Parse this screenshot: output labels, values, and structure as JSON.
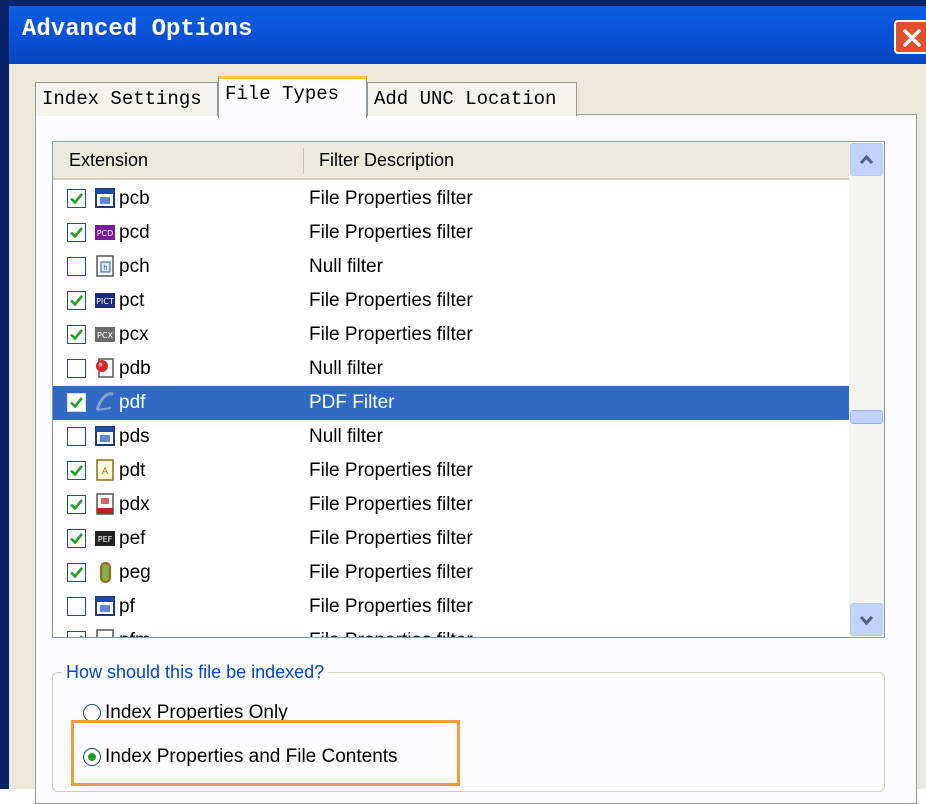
{
  "window": {
    "title": "Advanced Options"
  },
  "tabs": [
    {
      "label": "Index Settings",
      "active": false
    },
    {
      "label": "File Types",
      "active": true
    },
    {
      "label": "Add UNC Location",
      "active": false
    }
  ],
  "list": {
    "columns": {
      "extension": "Extension",
      "description": "Filter Description"
    },
    "rows": [
      {
        "checked": true,
        "ext": "pcb",
        "desc": "File Properties filter",
        "icon": "app-window-icon",
        "selected": false
      },
      {
        "checked": true,
        "ext": "pcd",
        "desc": "File Properties filter",
        "icon": "pcd-image-icon",
        "selected": false
      },
      {
        "checked": false,
        "ext": "pch",
        "desc": "Null filter",
        "icon": "header-file-icon",
        "selected": false
      },
      {
        "checked": true,
        "ext": "pct",
        "desc": "File Properties filter",
        "icon": "pict-image-icon",
        "selected": false
      },
      {
        "checked": true,
        "ext": "pcx",
        "desc": "File Properties filter",
        "icon": "pcx-image-icon",
        "selected": false
      },
      {
        "checked": false,
        "ext": "pdb",
        "desc": "Null filter",
        "icon": "database-file-icon",
        "selected": false
      },
      {
        "checked": true,
        "ext": "pdf",
        "desc": "PDF Filter",
        "icon": "pdf-file-icon",
        "selected": true
      },
      {
        "checked": false,
        "ext": "pds",
        "desc": "Null filter",
        "icon": "app-window-icon",
        "selected": false
      },
      {
        "checked": true,
        "ext": "pdt",
        "desc": "File Properties filter",
        "icon": "pdt-file-icon",
        "selected": false
      },
      {
        "checked": true,
        "ext": "pdx",
        "desc": "File Properties filter",
        "icon": "pdx-file-icon",
        "selected": false
      },
      {
        "checked": true,
        "ext": "pef",
        "desc": "File Properties filter",
        "icon": "pef-image-icon",
        "selected": false
      },
      {
        "checked": true,
        "ext": "peg",
        "desc": "File Properties filter",
        "icon": "peg-file-icon",
        "selected": false
      },
      {
        "checked": false,
        "ext": "pf",
        "desc": "File Properties filter",
        "icon": "app-window-icon",
        "selected": false
      },
      {
        "checked": true,
        "ext": "pfm",
        "desc": "File Properties filter",
        "icon": "font-file-icon",
        "selected": false
      }
    ]
  },
  "indexing": {
    "group_label": "How should this file be indexed?",
    "options": [
      {
        "label": "Index Properties Only",
        "selected": false
      },
      {
        "label": "Index Properties and File Contents",
        "selected": true
      }
    ]
  },
  "colors": {
    "title_bar": "#0b54d8",
    "selection": "#316ac5",
    "highlight_box": "#f39a3c",
    "group_label": "#0046d5"
  }
}
